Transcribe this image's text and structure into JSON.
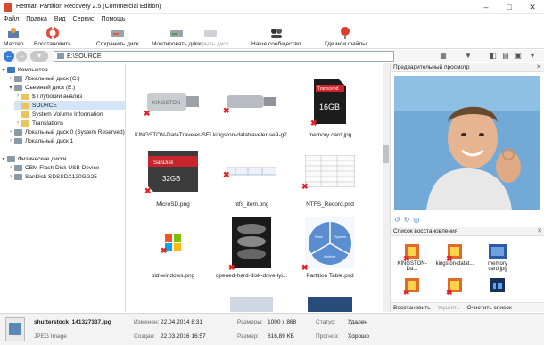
{
  "window": {
    "title": "Hetman Partition Recovery 2.5 (Commercial Edition)"
  },
  "menu": [
    "Файл",
    "Правка",
    "Вид",
    "Сервис",
    "Помощь"
  ],
  "toolbar": {
    "master": "Мастер",
    "restore": "Восстановить",
    "save_disk": "Сохранить диск",
    "mount_disk": "Монтировать диск",
    "close_disk": "Закрыть диск",
    "community": "Наше сообщество",
    "where_files": "Где мои файлы"
  },
  "address": {
    "path": "E:\\SOURCE"
  },
  "tree": [
    "Компьютер",
    "Локальный диск (C:)",
    "Съемный диск (E:)",
    "$ Глубокий анализ",
    "SOURCE",
    "System Volume Information",
    "Translations",
    "Локальный диск 0 (System Reserved)",
    "Локальный диск 1",
    "Физические диски",
    "CBM Flash Disk USB Device",
    "SanDisk SDSSDX120GG25"
  ],
  "files": [
    "KINGSTON-DataTraveler-SE9...",
    "kingston-datatraveler-se9-g2...",
    "memory card.jpg",
    "MicroSD.png",
    "ntfs_item.png",
    "NTFS_Record.psd",
    "old-windows.png",
    "opened-hard-disk-drive-lyi...",
    "Partition Table.psd"
  ],
  "file_thumb_text": {
    "kingston1": "KINGSTON",
    "sdhc_brand": "Transcend",
    "sdhc_size": "16GB",
    "micro_brand": "SanDisk",
    "micro_size": "32GB",
    "partition_left": "Work",
    "partition_right": "System",
    "partition_bottom": "Archive"
  },
  "preview": {
    "header": "Предварительный просмотр"
  },
  "recovery": {
    "header": "Список восстановления",
    "items": [
      "KINGSTON-Da...",
      "kingston-datat...",
      "memory card.jpg"
    ],
    "buttons": {
      "restore": "Восстановить",
      "delete": "Удалить",
      "clear": "Очистить список"
    }
  },
  "status": {
    "filename": "shutterstock_141327337.jpg",
    "filetype": "JPEG Image",
    "changed_label": "Изменен:",
    "changed": "22.04.2014 8:31",
    "created_label": "Создан:",
    "created": "22.03.2016 16:57",
    "dims_label": "Размеры:",
    "dims": "1000 x 868",
    "size_label": "Размер:",
    "size": "616,89 КБ",
    "state_label": "Статус:",
    "state": "Удален",
    "forecast_label": "Прогноз:",
    "forecast": "Хорошо"
  },
  "colors": {
    "accent": "#3a7bd5",
    "deleted_mark": "#e0232b",
    "selection": "#d4e5f7"
  },
  "icons": [
    "wizard-icon",
    "lifebuoy-icon",
    "hdd-save-icon",
    "hdd-mount-icon",
    "hdd-close-icon",
    "community-icon",
    "pin-icon"
  ]
}
